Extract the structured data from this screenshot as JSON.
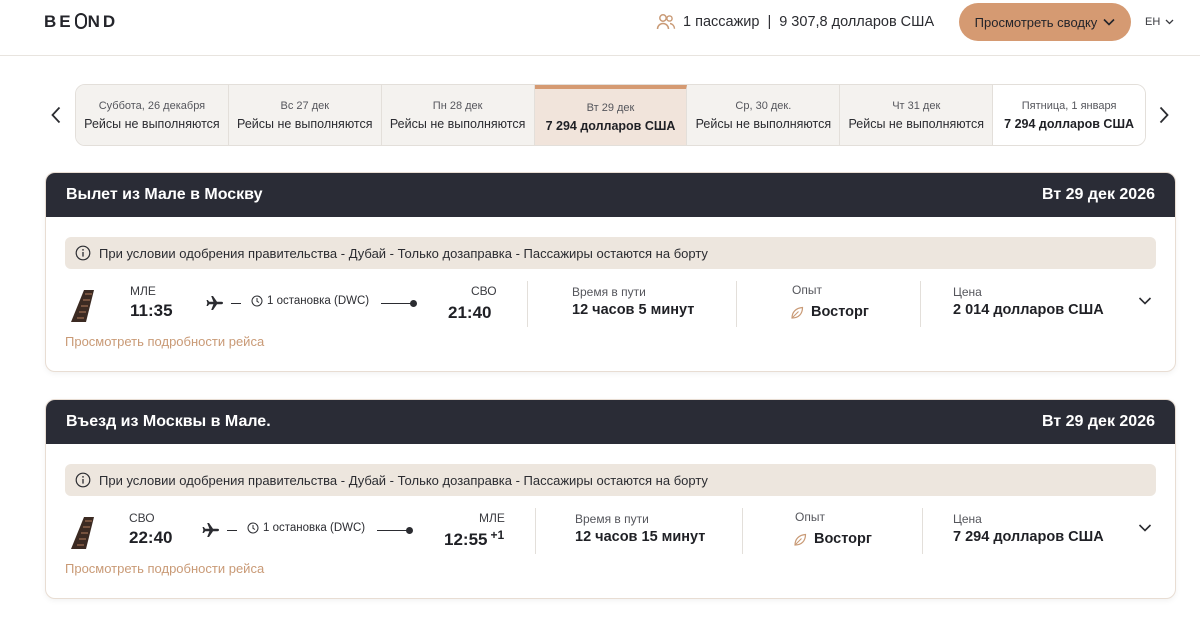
{
  "header": {
    "logo_left": "BE",
    "logo_right": "ND",
    "passengers": "1 пассажир",
    "separator": "|",
    "total": "9 307,8 долларов США",
    "summary_button": "Просмотреть сводку",
    "language": "ЕН"
  },
  "dates": [
    {
      "date": "Суббота, 26 декабря",
      "status": "Рейсы не выполняются"
    },
    {
      "date": "Вс 27 дек",
      "status": "Рейсы не выполняются"
    },
    {
      "date": "Пн 28 дек",
      "status": "Рейсы не выполняются"
    },
    {
      "date": "Вт 29 дек",
      "status": "7 294 долларов США"
    },
    {
      "date": "Ср, 30 дек.",
      "status": "Рейсы не выполняются"
    },
    {
      "date": "Чт 31 дек",
      "status": "Рейсы не выполняются"
    },
    {
      "date": "Пятница, 1 января",
      "status": "7 294 долларов США"
    }
  ],
  "outbound": {
    "title": "Вылет из Мале в Москву",
    "date": "Вт 29 дек 2026",
    "notice": "При условии одобрения правительства - Дубай - Только дозаправка - Пассажиры остаются на борту",
    "from_code": "МЛЕ",
    "from_time": "11:35",
    "stops": "1 остановка (DWC)",
    "to_code": "СВО",
    "to_time": "21:40",
    "to_day_offset": "",
    "duration_label": "Время в пути",
    "duration": "12 часов 5 минут",
    "experience_label": "Опыт",
    "experience": "Восторг",
    "price_label": "Цена",
    "price": "2 014 долларов США",
    "details_link": "Просмотреть подробности рейса"
  },
  "inbound": {
    "title": "Въезд из Москвы в Мале.",
    "date": "Вт 29 дек 2026",
    "notice": "При условии одобрения правительства - Дубай - Только дозаправка - Пассажиры остаются на борту",
    "from_code": "СВО",
    "from_time": "22:40",
    "stops": "1 остановка (DWC)",
    "to_code": "МЛЕ",
    "to_time": "12:55",
    "to_day_offset": "+1",
    "duration_label": "Время в пути",
    "duration": "12 часов 15 минут",
    "experience_label": "Опыт",
    "experience": "Восторг",
    "price_label": "Цена",
    "price": "7 294 долларов США",
    "details_link": "Просмотреть подробности рейса"
  },
  "colors": {
    "accent": "#d59a72",
    "card_header": "#2a2c36",
    "notice_bg": "#ede6de",
    "selected_date_bg": "#f1e4db",
    "link": "#c99a76"
  },
  "icons": [
    "passengers-icon",
    "chevron-down-icon",
    "chevron-left-icon",
    "chevron-right-icon",
    "info-icon",
    "airline-tail-icon",
    "plane-icon",
    "clock-icon",
    "leaf-icon"
  ]
}
